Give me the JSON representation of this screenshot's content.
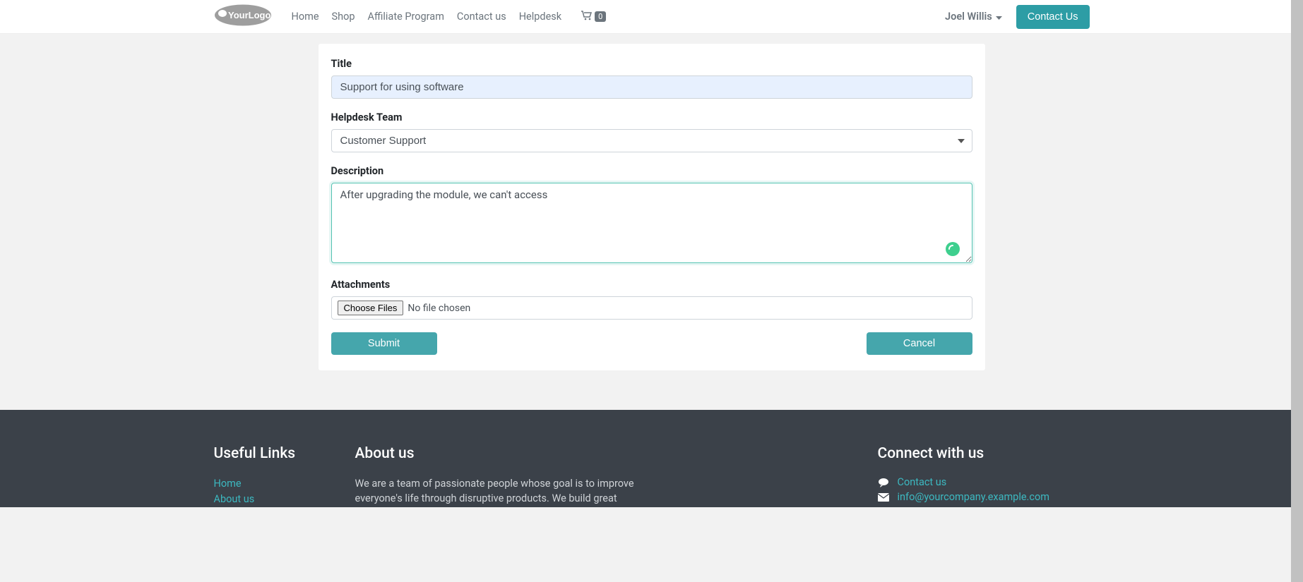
{
  "nav": {
    "links": [
      "Home",
      "Shop",
      "Affiliate Program",
      "Contact us",
      "Helpdesk"
    ],
    "cart_count": "0",
    "user_name": "Joel Willis",
    "contact_btn": "Contact Us"
  },
  "form": {
    "title_label": "Title",
    "title_value": "Support for using software",
    "team_label": "Helpdesk Team",
    "team_selected": "Customer Support",
    "description_label": "Description",
    "description_value": "After upgrading the module, we can't access",
    "attachments_label": "Attachments",
    "choose_files_btn": "Choose Files",
    "file_status": "No file chosen",
    "submit_btn": "Submit",
    "cancel_btn": "Cancel"
  },
  "footer": {
    "useful_title": "Useful Links",
    "useful_links": [
      "Home",
      "About us"
    ],
    "about_title": "About us",
    "about_text": "We are a team of passionate people whose goal is to improve everyone's life through disruptive products. We build great",
    "connect_title": "Connect with us",
    "contact_link": "Contact us",
    "email": "info@yourcompany.example.com"
  }
}
